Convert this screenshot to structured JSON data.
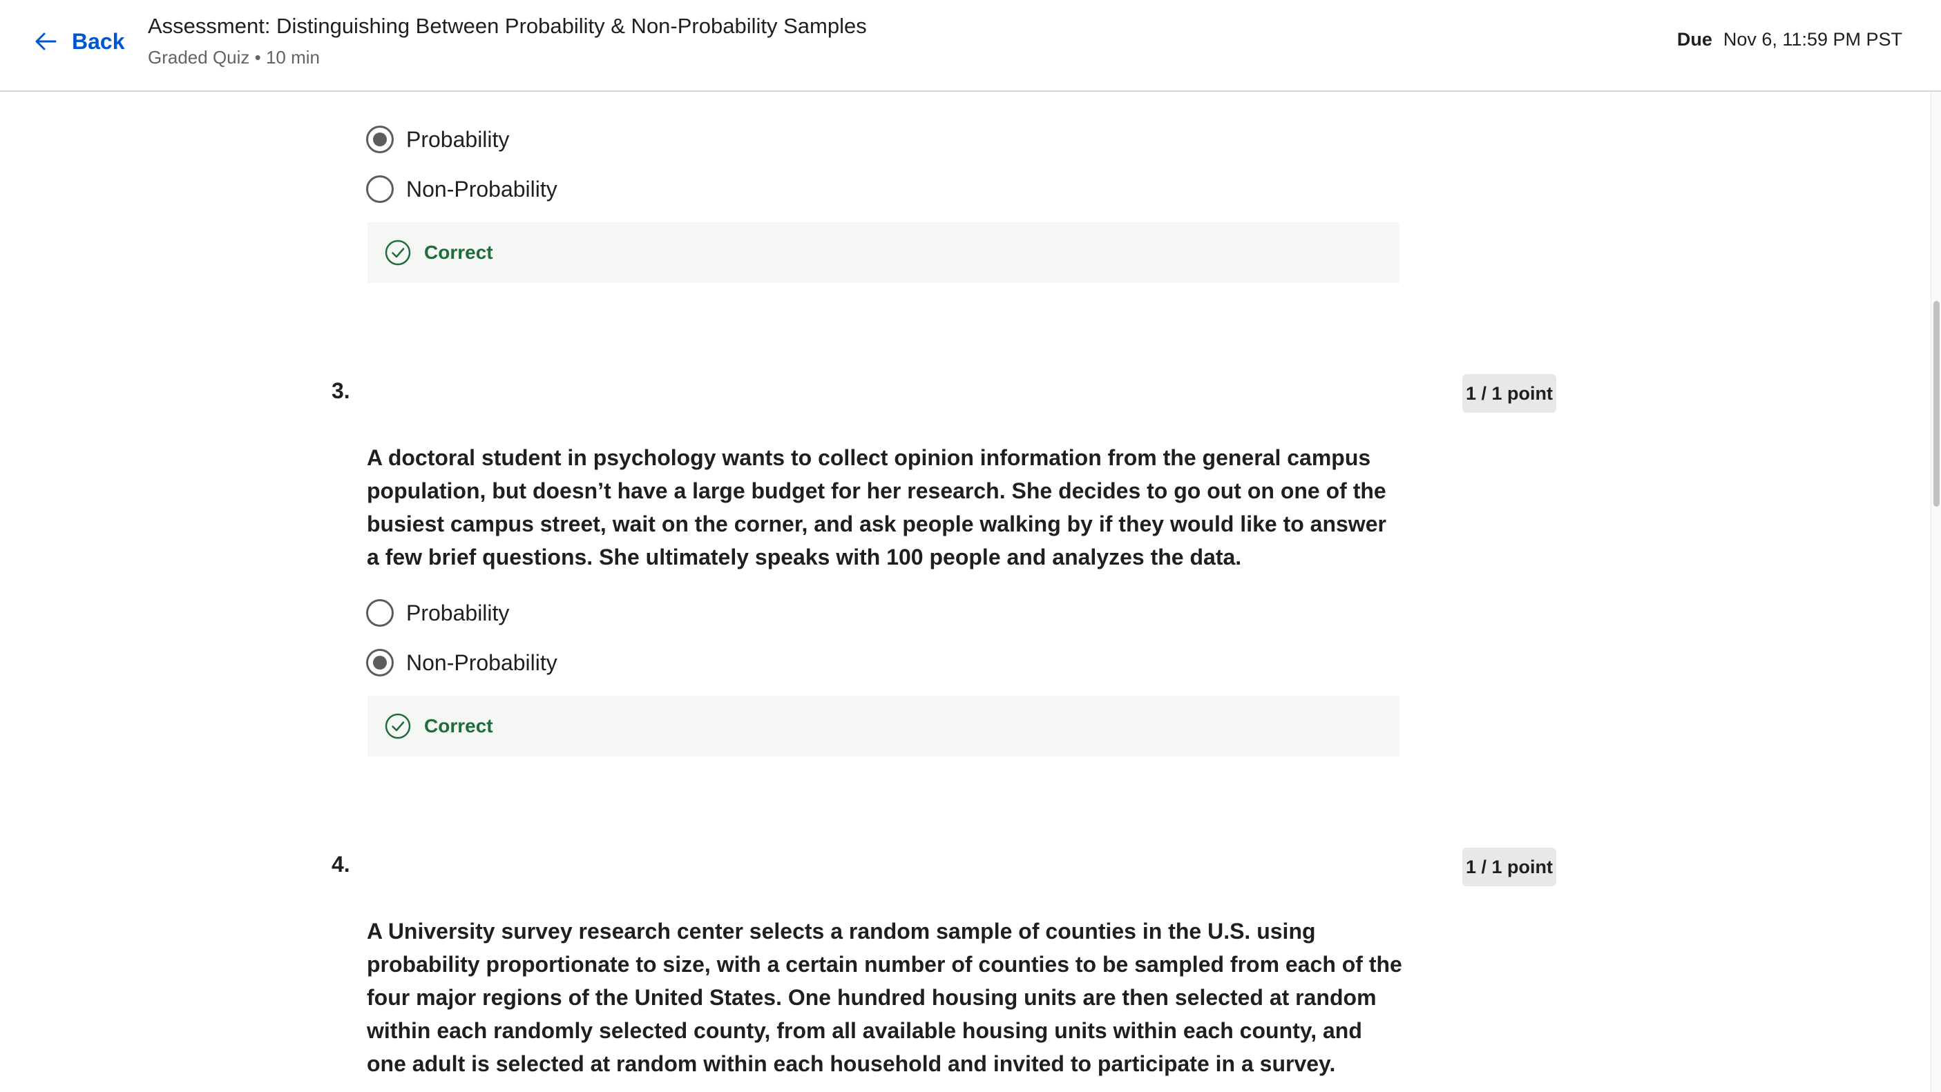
{
  "header": {
    "back_label": "Back",
    "title": "Assessment: Distinguishing Between Probability & Non-Probability Samples",
    "subtitle": "Graded Quiz • 10 min",
    "due_label": "Due",
    "due_value": "Nov 6, 11:59 PM PST"
  },
  "questions": [
    {
      "number": "",
      "options": [
        {
          "label": "Probability",
          "selected": true
        },
        {
          "label": "Non-Probability",
          "selected": false
        }
      ],
      "feedback": "Correct"
    },
    {
      "number": "3.",
      "points": "1 / 1 point",
      "text": "A doctoral student in psychology wants to collect opinion information from the general campus population, but doesn’t have a large budget for her research. She decides to go out on one of the busiest campus street, wait on the corner, and ask people walking by if they would like to answer a few brief questions. She ultimately speaks with 100 people and analyzes the data.",
      "options": [
        {
          "label": "Probability",
          "selected": false
        },
        {
          "label": "Non-Probability",
          "selected": true
        }
      ],
      "feedback": "Correct"
    },
    {
      "number": "4.",
      "points": "1 / 1 point",
      "text": "A University survey research center selects a random sample of counties in the U.S. using probability proportionate to size, with a certain number of counties to be sampled from each of the four major regions of the United States. One hundred housing units are then selected at random within each randomly selected county, from all available housing units within each county, and one adult is selected at random within each household and invited to participate in a survey."
    }
  ],
  "colors": {
    "link_blue": "#0056d2",
    "correct_green": "#1f6b3a",
    "feedback_bg": "#f5f7f5",
    "badge_bg": "#e8e8e8"
  }
}
